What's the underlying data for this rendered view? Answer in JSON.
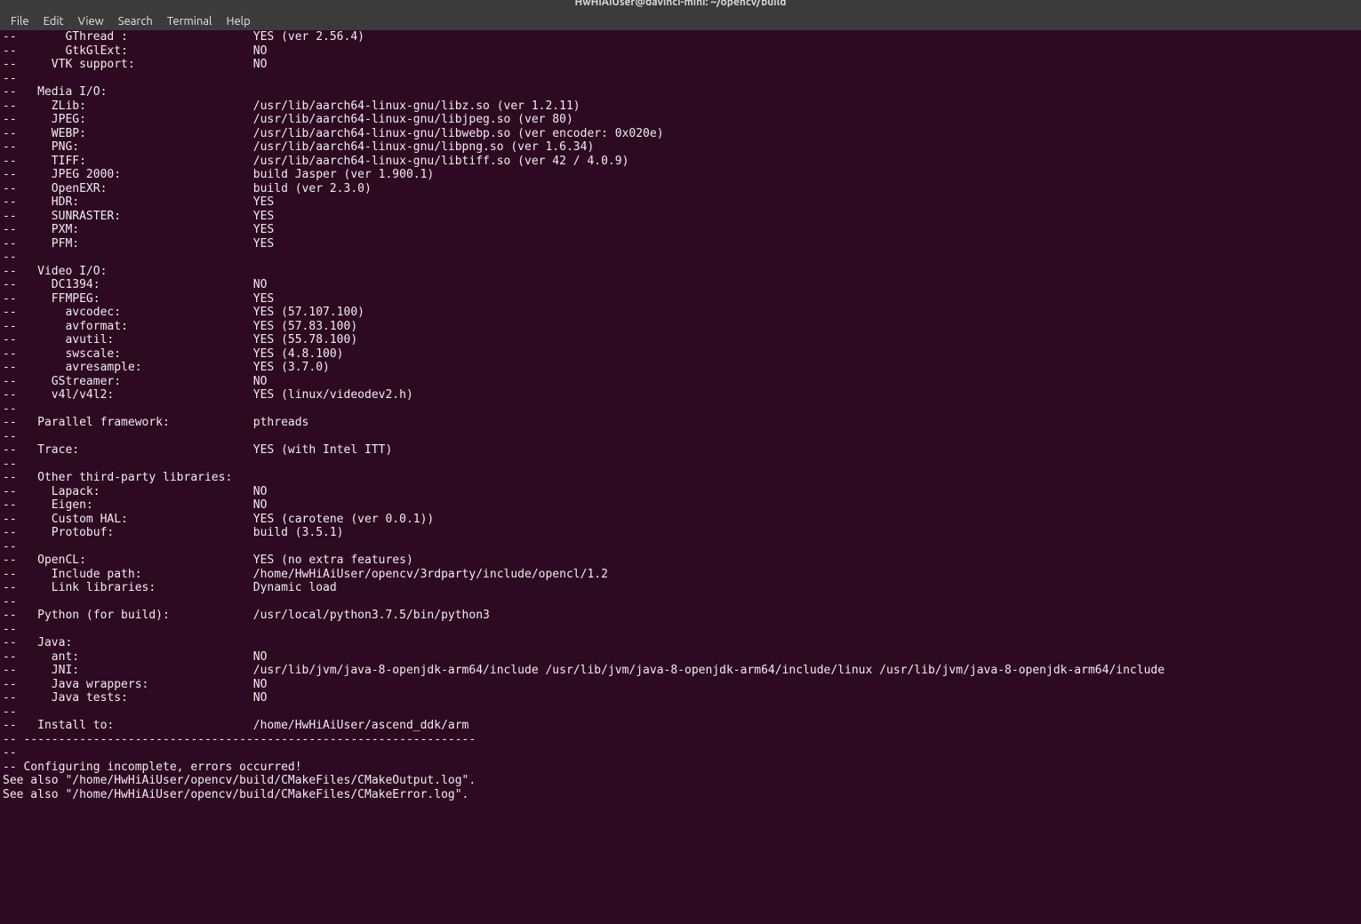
{
  "window": {
    "title": "HwHiAiUser@davinci-mini: ~/opencv/build"
  },
  "menu": [
    "File",
    "Edit",
    "View",
    "Search",
    "Terminal",
    "Help"
  ],
  "prefix": "--",
  "indent": {
    "l1": "   ",
    "l2": "     ",
    "l3": "       "
  },
  "valueCol": 36,
  "sections": {
    "gui_tail": [
      {
        "lvl": 3,
        "key": "GThread :",
        "val": "YES (ver 2.56.4)"
      },
      {
        "lvl": 3,
        "key": "GtkGlExt:",
        "val": "NO"
      },
      {
        "lvl": 2,
        "key": "VTK support:",
        "val": "NO"
      }
    ],
    "media_io": {
      "title": "Media I/O:",
      "rows": [
        {
          "lvl": 2,
          "key": "ZLib:",
          "val": "/usr/lib/aarch64-linux-gnu/libz.so (ver 1.2.11)"
        },
        {
          "lvl": 2,
          "key": "JPEG:",
          "val": "/usr/lib/aarch64-linux-gnu/libjpeg.so (ver 80)"
        },
        {
          "lvl": 2,
          "key": "WEBP:",
          "val": "/usr/lib/aarch64-linux-gnu/libwebp.so (ver encoder: 0x020e)"
        },
        {
          "lvl": 2,
          "key": "PNG:",
          "val": "/usr/lib/aarch64-linux-gnu/libpng.so (ver 1.6.34)"
        },
        {
          "lvl": 2,
          "key": "TIFF:",
          "val": "/usr/lib/aarch64-linux-gnu/libtiff.so (ver 42 / 4.0.9)"
        },
        {
          "lvl": 2,
          "key": "JPEG 2000:",
          "val": "build Jasper (ver 1.900.1)"
        },
        {
          "lvl": 2,
          "key": "OpenEXR:",
          "val": "build (ver 2.3.0)"
        },
        {
          "lvl": 2,
          "key": "HDR:",
          "val": "YES"
        },
        {
          "lvl": 2,
          "key": "SUNRASTER:",
          "val": "YES"
        },
        {
          "lvl": 2,
          "key": "PXM:",
          "val": "YES"
        },
        {
          "lvl": 2,
          "key": "PFM:",
          "val": "YES"
        }
      ]
    },
    "video_io": {
      "title": "Video I/O:",
      "rows": [
        {
          "lvl": 2,
          "key": "DC1394:",
          "val": "NO"
        },
        {
          "lvl": 2,
          "key": "FFMPEG:",
          "val": "YES"
        },
        {
          "lvl": 3,
          "key": "avcodec:",
          "val": "YES (57.107.100)"
        },
        {
          "lvl": 3,
          "key": "avformat:",
          "val": "YES (57.83.100)"
        },
        {
          "lvl": 3,
          "key": "avutil:",
          "val": "YES (55.78.100)"
        },
        {
          "lvl": 3,
          "key": "swscale:",
          "val": "YES (4.8.100)"
        },
        {
          "lvl": 3,
          "key": "avresample:",
          "val": "YES (3.7.0)"
        },
        {
          "lvl": 2,
          "key": "GStreamer:",
          "val": "NO"
        },
        {
          "lvl": 2,
          "key": "v4l/v4l2:",
          "val": "YES (linux/videodev2.h)"
        }
      ]
    },
    "parallel": {
      "lvl": 1,
      "key": "Parallel framework:",
      "val": "pthreads"
    },
    "trace": {
      "lvl": 1,
      "key": "Trace:",
      "val": "YES (with Intel ITT)"
    },
    "third_party": {
      "title": "Other third-party libraries:",
      "rows": [
        {
          "lvl": 2,
          "key": "Lapack:",
          "val": "NO"
        },
        {
          "lvl": 2,
          "key": "Eigen:",
          "val": "NO"
        },
        {
          "lvl": 2,
          "key": "Custom HAL:",
          "val": "YES (carotene (ver 0.0.1))"
        },
        {
          "lvl": 2,
          "key": "Protobuf:",
          "val": "build (3.5.1)"
        }
      ]
    },
    "opencl": {
      "title_row": {
        "lvl": 1,
        "key": "OpenCL:",
        "val": "YES (no extra features)"
      },
      "rows": [
        {
          "lvl": 2,
          "key": "Include path:",
          "val": "/home/HwHiAiUser/opencv/3rdparty/include/opencl/1.2"
        },
        {
          "lvl": 2,
          "key": "Link libraries:",
          "val": "Dynamic load"
        }
      ]
    },
    "python": {
      "lvl": 1,
      "key": "Python (for build):",
      "val": "/usr/local/python3.7.5/bin/python3"
    },
    "java": {
      "title": "Java:",
      "rows": [
        {
          "lvl": 2,
          "key": "ant:",
          "val": "NO"
        },
        {
          "lvl": 2,
          "key": "JNI:",
          "val": "/usr/lib/jvm/java-8-openjdk-arm64/include /usr/lib/jvm/java-8-openjdk-arm64/include/linux /usr/lib/jvm/java-8-openjdk-arm64/include"
        },
        {
          "lvl": 2,
          "key": "Java wrappers:",
          "val": "NO"
        },
        {
          "lvl": 2,
          "key": "Java tests:",
          "val": "NO"
        }
      ]
    },
    "install": {
      "lvl": 1,
      "key": "Install to:",
      "val": "/home/HwHiAiUser/ascend_ddk/arm"
    },
    "rule": "-- -----------------------------------------------------------------",
    "footer": [
      "-- Configuring incomplete, errors occurred!",
      "See also \"/home/HwHiAiUser/opencv/build/CMakeFiles/CMakeOutput.log\".",
      "See also \"/home/HwHiAiUser/opencv/build/CMakeFiles/CMakeError.log\"."
    ]
  }
}
